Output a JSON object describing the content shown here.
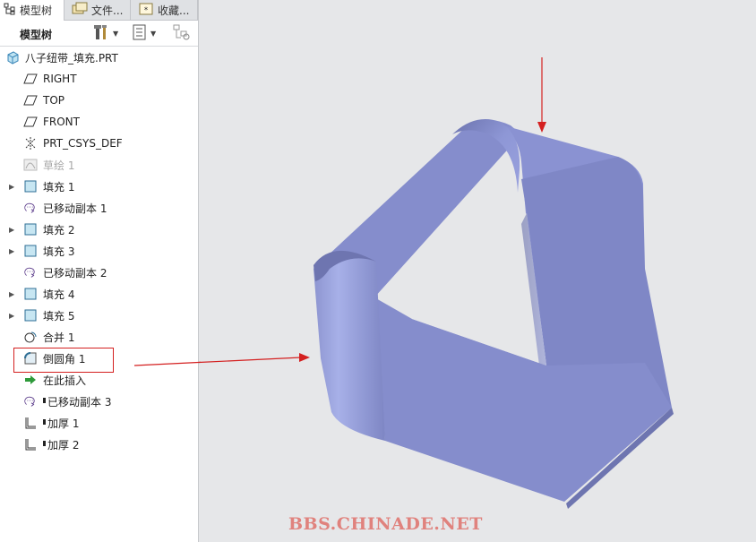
{
  "tabs": [
    {
      "label": "模型树",
      "icon": "model-tree-icon"
    },
    {
      "label": "文件...",
      "icon": "folder-icon"
    },
    {
      "label": "收藏...",
      "icon": "favorites-icon"
    }
  ],
  "toolbar": {
    "title": "模型树"
  },
  "tree": {
    "root": "八子纽带_填充.PRT",
    "items": [
      {
        "label": "RIGHT",
        "icon": "datum-plane-icon"
      },
      {
        "label": "TOP",
        "icon": "datum-plane-icon"
      },
      {
        "label": "FRONT",
        "icon": "datum-plane-icon"
      },
      {
        "label": "PRT_CSYS_DEF",
        "icon": "csys-icon"
      },
      {
        "label": "草绘 1",
        "icon": "sketch-icon"
      },
      {
        "label": "填充 1",
        "icon": "fill-icon"
      },
      {
        "label": "已移动副本 1",
        "icon": "moved-copy-icon"
      },
      {
        "label": "填充 2",
        "icon": "fill-icon"
      },
      {
        "label": "填充 3",
        "icon": "fill-icon"
      },
      {
        "label": "已移动副本 2",
        "icon": "moved-copy-icon"
      },
      {
        "label": "填充 4",
        "icon": "fill-icon"
      },
      {
        "label": "填充 5",
        "icon": "fill-icon"
      },
      {
        "label": "合并 1",
        "icon": "merge-icon"
      },
      {
        "label": "倒圆角 1",
        "icon": "round-icon"
      },
      {
        "label": "在此插入",
        "icon": "insert-here-icon"
      },
      {
        "label": "已移动副本 3",
        "icon": "moved-copy-icon"
      },
      {
        "label": "加厚 1",
        "icon": "thicken-icon"
      },
      {
        "label": "加厚 2",
        "icon": "thicken-icon"
      }
    ]
  },
  "watermark": "BBS.CHINADE.NET",
  "colors": {
    "surface": "#8a92cf",
    "annotation": "#d42020",
    "watermark": "#e0827d"
  }
}
